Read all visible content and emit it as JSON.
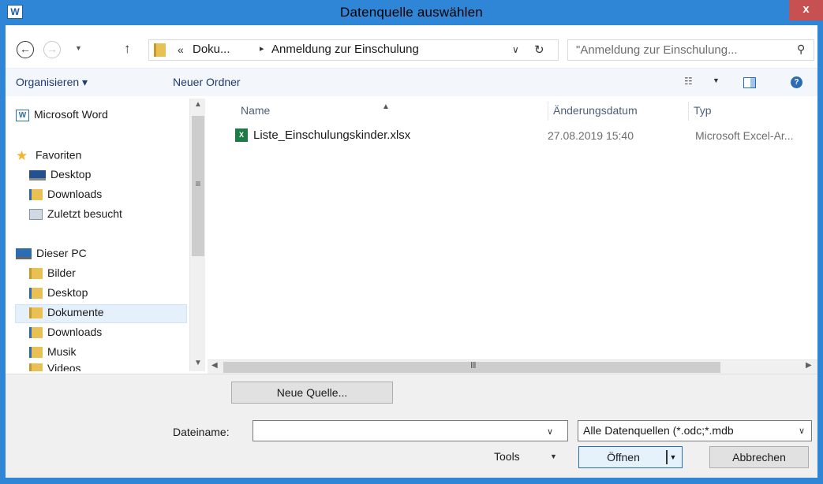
{
  "window": {
    "title": "Datenquelle auswählen",
    "app_icon_glyph": "W",
    "close_glyph": "x"
  },
  "address": {
    "prefix": "«",
    "segments": [
      "Doku...",
      "Anmeldung zur Einschulung"
    ],
    "separator": "▸",
    "search_placeholder": "\"Anmeldung zur Einschulung..."
  },
  "toolbar": {
    "organize_label": "Organisieren ▾",
    "new_folder_label": "Neuer Ordner"
  },
  "nav_pane": {
    "items": [
      {
        "label": "Microsoft Word",
        "icon": "word-icon"
      },
      {
        "label": "Favoriten",
        "icon": "star-icon"
      },
      {
        "label": "Desktop",
        "icon": "desktop-icon"
      },
      {
        "label": "Downloads",
        "icon": "downloads-folder-icon"
      },
      {
        "label": "Zuletzt besucht",
        "icon": "recent-places-icon"
      },
      {
        "label": "Dieser PC",
        "icon": "computer-icon"
      },
      {
        "label": "Bilder",
        "icon": "pictures-folder-icon"
      },
      {
        "label": "Desktop",
        "icon": "desktop-folder-icon"
      },
      {
        "label": "Dokumente",
        "icon": "documents-folder-icon",
        "selected": true
      },
      {
        "label": "Downloads",
        "icon": "downloads-folder-icon"
      },
      {
        "label": "Musik",
        "icon": "music-folder-icon"
      },
      {
        "label": "Videos",
        "icon": "videos-folder-icon"
      }
    ]
  },
  "file_list": {
    "columns": [
      "Name",
      "Änderungsdatum",
      "Typ"
    ],
    "rows": [
      {
        "name": "Liste_Einschulungskinder.xlsx",
        "date": "27.08.2019 15:40",
        "type": "Microsoft Excel-Ar...",
        "icon": "excel-file-icon"
      }
    ]
  },
  "bottom": {
    "new_source_label": "Neue Quelle...",
    "filename_label": "Dateiname:",
    "filename_value": "",
    "filter_value": "Alle Datenquellen (*.odc;*.mdb",
    "tools_label": "Tools",
    "open_label": "Öffnen",
    "cancel_label": "Abbrechen"
  },
  "colors": {
    "title_bar": "#2f86d6",
    "close_button": "#c75050",
    "command_bar": "#f3f7fb",
    "selection": "#e5f0fb"
  }
}
